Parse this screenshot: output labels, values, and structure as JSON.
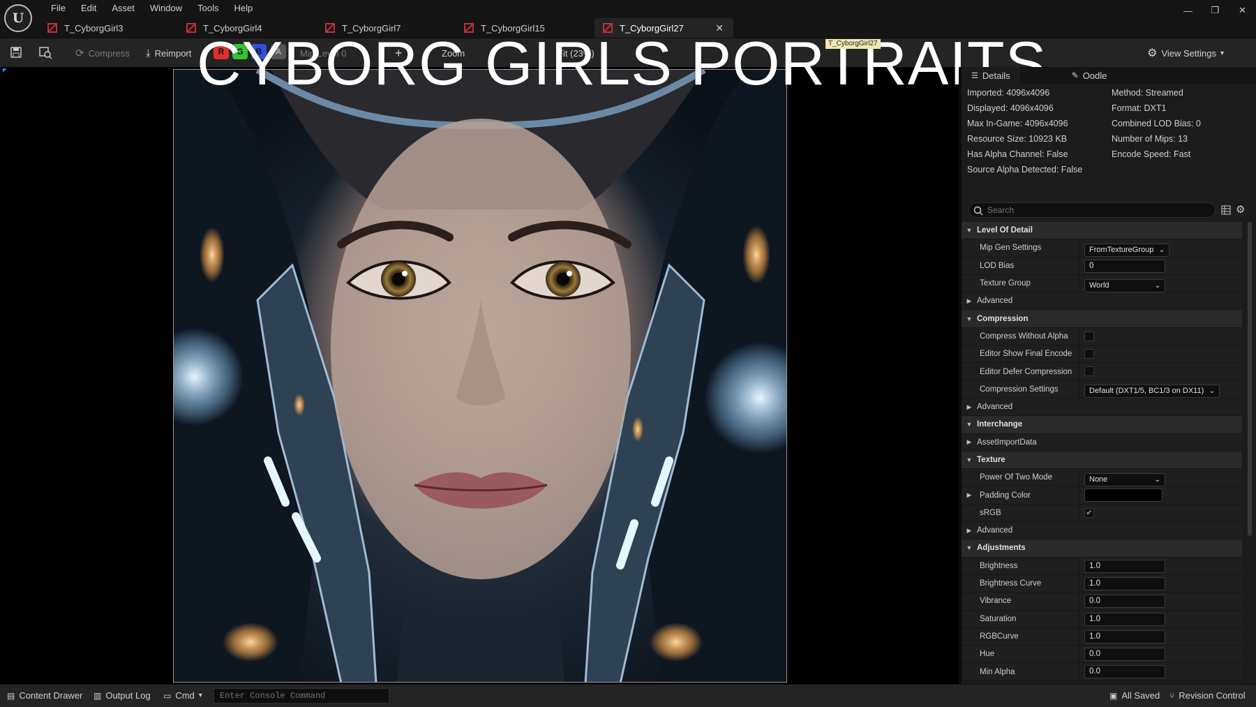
{
  "menu": [
    "File",
    "Edit",
    "Asset",
    "Window",
    "Tools",
    "Help"
  ],
  "tabs": [
    {
      "label": "T_CyborgGirl3"
    },
    {
      "label": "T_CyborgGirl4"
    },
    {
      "label": "T_CyborgGirl7"
    },
    {
      "label": "T_CyborgGirl15"
    },
    {
      "label": "T_CyborgGirl27",
      "active": true
    }
  ],
  "toolbar": {
    "compress": "Compress",
    "reimport": "Reimport",
    "channels": [
      "R",
      "G",
      "B",
      "A"
    ],
    "mip_level": "Mip Level 0",
    "zoom_label": "Zoom",
    "zoom_value": "Fit (23%)",
    "view_settings": "View Settings"
  },
  "overlay": {
    "title": "CYBORG GIRLS PORTRAITS",
    "tooltip": "T_CyborgGirl27"
  },
  "panel": {
    "tabs": [
      "Details",
      "Oodle"
    ],
    "info_left": [
      "Imported: 4096x4096",
      "Displayed: 4096x4096",
      "Max In-Game: 4096x4096",
      "Resource Size: 10923 KB",
      "Has Alpha Channel: False",
      "Source Alpha Detected: False"
    ],
    "info_right": [
      "Method: Streamed",
      "Format: DXT1",
      "Combined LOD Bias: 0",
      "Number of Mips: 13",
      "Encode Speed: Fast"
    ],
    "search_placeholder": "Search",
    "rows": [
      {
        "type": "cat",
        "label": "Level Of Detail"
      },
      {
        "type": "prop",
        "label": "Mip Gen Settings",
        "kind": "dropdown",
        "value": "FromTextureGroup"
      },
      {
        "type": "prop",
        "label": "LOD Bias",
        "kind": "field",
        "value": "0"
      },
      {
        "type": "prop",
        "label": "Texture Group",
        "kind": "dropdown",
        "value": "World",
        "wide": true
      },
      {
        "type": "sub",
        "label": "Advanced"
      },
      {
        "type": "cat",
        "label": "Compression"
      },
      {
        "type": "prop",
        "label": "Compress Without Alpha",
        "kind": "checkbox",
        "value": false
      },
      {
        "type": "prop",
        "label": "Editor Show Final Encode",
        "kind": "checkbox",
        "value": false
      },
      {
        "type": "prop",
        "label": "Editor Defer Compression",
        "kind": "checkbox",
        "value": false
      },
      {
        "type": "prop",
        "label": "Compression Settings",
        "kind": "dropdown",
        "value": "Default (DXT1/5, BC1/3 on DX11)"
      },
      {
        "type": "sub",
        "label": "Advanced"
      },
      {
        "type": "cat",
        "label": "Interchange"
      },
      {
        "type": "sub",
        "label": "AssetImportData"
      },
      {
        "type": "cat",
        "label": "Texture"
      },
      {
        "type": "prop",
        "label": "Power Of Two Mode",
        "kind": "dropdown",
        "value": "None",
        "wide": true
      },
      {
        "type": "prop",
        "label": "Padding Color",
        "kind": "color",
        "value": "#000000",
        "expandable": true
      },
      {
        "type": "prop",
        "label": "sRGB",
        "kind": "checkbox",
        "value": true
      },
      {
        "type": "sub",
        "label": "Advanced"
      },
      {
        "type": "cat",
        "label": "Adjustments"
      },
      {
        "type": "prop",
        "label": "Brightness",
        "kind": "field",
        "value": "1.0"
      },
      {
        "type": "prop",
        "label": "Brightness Curve",
        "kind": "field",
        "value": "1.0"
      },
      {
        "type": "prop",
        "label": "Vibrance",
        "kind": "field",
        "value": "0.0"
      },
      {
        "type": "prop",
        "label": "Saturation",
        "kind": "field",
        "value": "1.0"
      },
      {
        "type": "prop",
        "label": "RGBCurve",
        "kind": "field",
        "value": "1.0"
      },
      {
        "type": "prop",
        "label": "Hue",
        "kind": "field",
        "value": "0.0"
      },
      {
        "type": "prop",
        "label": "Min Alpha",
        "kind": "field",
        "value": "0.0"
      }
    ]
  },
  "statusbar": {
    "content_drawer": "Content Drawer",
    "output_log": "Output Log",
    "cmd": "Cmd",
    "console_placeholder": "Enter Console Command",
    "all_saved": "All Saved",
    "revision_control": "Revision Control"
  },
  "colors": {
    "accent": "#2a7fff",
    "channel_r": "#e0302a",
    "channel_g": "#31c431",
    "channel_b": "#2f4fe0",
    "channel_a": "#555555",
    "tab_icon": "#c0303a"
  }
}
